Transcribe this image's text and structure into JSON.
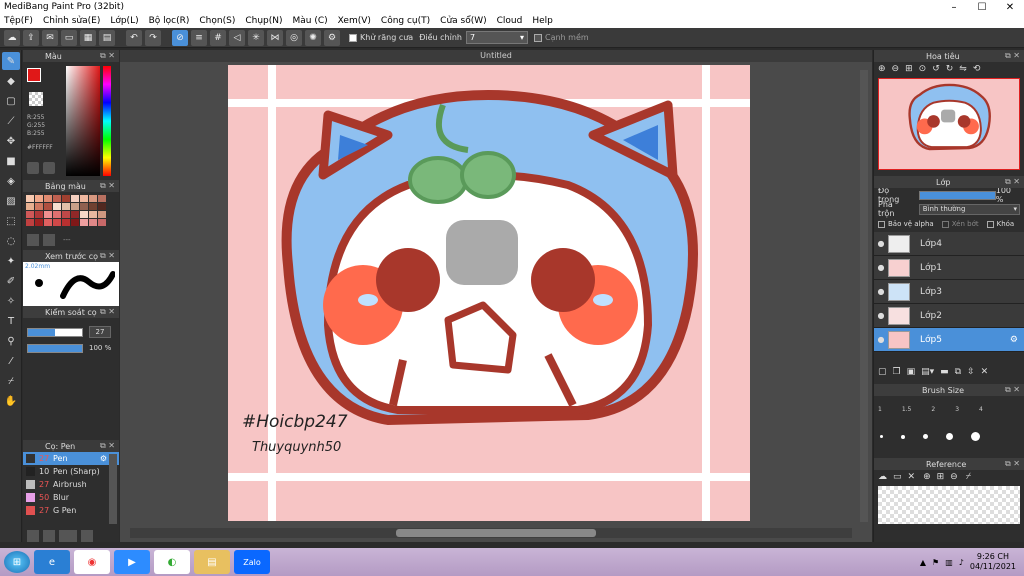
{
  "window": {
    "title": "MediBang Paint Pro (32bit)",
    "controls": [
      "–",
      "☐",
      "✕"
    ]
  },
  "menu": [
    "Tệp(F)",
    "Chỉnh sửa(E)",
    "Lớp(L)",
    "Bộ lọc(R)",
    "Chọn(S)",
    "Chụp(N)",
    "Màu (C)",
    "Xem(V)",
    "Công cụ(T)",
    "Cửa sổ(W)",
    "Cloud",
    "Help"
  ],
  "toolbar": {
    "antialias_label": "Khử răng cưa",
    "adjust_label": "Điều chỉnh",
    "adjust_value": "7",
    "edge_label": "Cạnh mềm"
  },
  "color_panel": {
    "title": "Màu",
    "r": "R:255",
    "g": "G:255",
    "b": "B:255",
    "hex": "#FFFFFF"
  },
  "palette_panel": {
    "title": "Bảng màu",
    "extra": "---"
  },
  "preview_panel": {
    "title": "Xem trước cọ",
    "size": "2.02mm"
  },
  "brush_control": {
    "title": "Kiểm soát cọ",
    "size_value": "27",
    "opacity_value": "100 %"
  },
  "brush_list": {
    "title": "Cọ: Pen",
    "items": [
      {
        "num": "27",
        "name": "Pen",
        "color": "#333333"
      },
      {
        "num": "10",
        "name": "Pen (Sharp)",
        "color": "#222222"
      },
      {
        "num": "27",
        "name": "Airbrush",
        "color": "#bbbbbb"
      },
      {
        "num": "50",
        "name": "Blur",
        "color": "#e8a0e8"
      },
      {
        "num": "27",
        "name": "G Pen",
        "color": "#e05050"
      }
    ]
  },
  "canvas": {
    "tab_title": "Untitled",
    "signature_line1": "#Hoicbp247",
    "signature_line2": "Thuyquynh50"
  },
  "navigator": {
    "title": "Hoa tiêu"
  },
  "layers": {
    "title": "Lớp",
    "opacity_label": "Độ trong",
    "opacity_value": "100 %",
    "blend_label": "Pha trộn",
    "blend_value": "Bình thường",
    "protect_alpha": "Bảo vệ alpha",
    "clipping": "Xén bớt",
    "lock": "Khóa",
    "items": [
      "Lớp4",
      "Lớp1",
      "Lớp3",
      "Lớp2",
      "Lớp5"
    ]
  },
  "brush_size": {
    "title": "Brush Size",
    "labels": [
      "1",
      "1.5",
      "2",
      "3",
      "4"
    ]
  },
  "reference": {
    "title": "Reference"
  },
  "taskbar": {
    "time": "9:26 CH",
    "date": "04/11/2021",
    "zalo": "Zalo"
  },
  "colors": {
    "canvas_bg": "#f7c5c5",
    "outline": "#a8372b",
    "hood": "#8fc0f0",
    "hood_dark": "#3d7fd9",
    "cheek": "#ff6a4d",
    "eye": "#a8372b",
    "nose": "#aaaaaa",
    "sprout": "#5a9a5a",
    "accent": "#4a90d9"
  }
}
